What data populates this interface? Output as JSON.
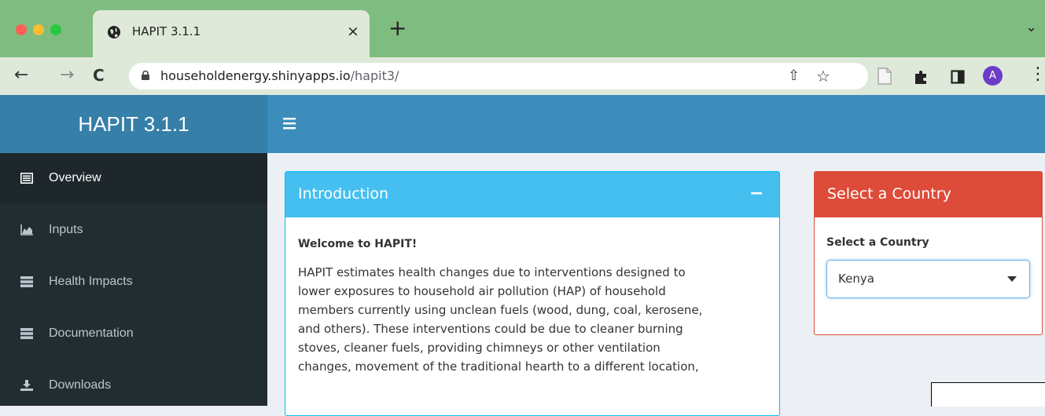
{
  "browser": {
    "tab_title": "HAPIT 3.1.1",
    "tab_close": "×",
    "new_tab": "+",
    "tab_menu": "⌄",
    "back": "←",
    "forward": "→",
    "reload": "C",
    "url_host": "householdenergy.shinyapps.io",
    "url_path": "/hapit3/",
    "share": "⇧",
    "bookmark": "☆",
    "profile_initial": "A",
    "menu": "⋮"
  },
  "app": {
    "brand": "HAPIT 3.1.1"
  },
  "sidebar": {
    "items": [
      {
        "label": "Overview",
        "icon": "list-alt-icon",
        "active": true
      },
      {
        "label": "Inputs",
        "icon": "area-chart-icon"
      },
      {
        "label": "Health Impacts",
        "icon": "server-icon"
      },
      {
        "label": "Documentation",
        "icon": "server-icon"
      },
      {
        "label": "Downloads",
        "icon": "download-icon"
      }
    ]
  },
  "intro_box": {
    "title": "Introduction",
    "collapse": "−",
    "welcome": "Welcome to HAPIT!",
    "lines": [
      "HAPIT estimates health changes due to interventions designed to",
      "lower exposures to household air pollution (HAP) of household",
      "members currently using unclean fuels (wood, dung, coal, kerosene,",
      "and others). These interventions could be due to cleaner burning",
      "stoves, cleaner fuels, providing chimneys or other ventilation",
      "changes, movement of the traditional hearth to a different location,"
    ]
  },
  "country_box": {
    "title": "Select a Country",
    "field_label": "Select a Country",
    "selected": "Kenya"
  },
  "colors": {
    "tab_strip": "#7fbc7f",
    "header": "#3c8dbc",
    "brand": "#367fa9",
    "sidebar": "#222d32",
    "intro_header": "#44bff0",
    "country_header": "#dd4b39"
  }
}
